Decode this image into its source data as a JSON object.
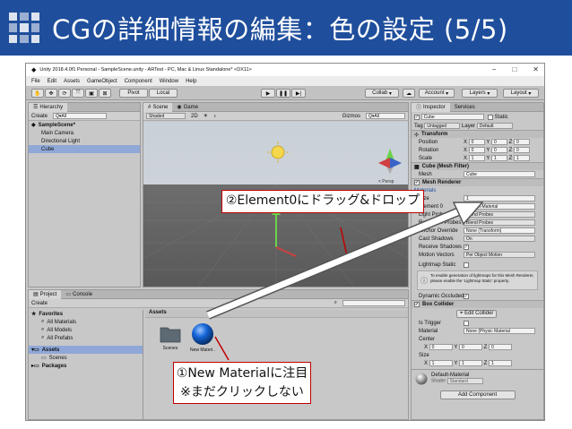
{
  "slide": {
    "title": "CGの詳細情報の編集：色の設定 (5/5)"
  },
  "window": {
    "title": "Unity 2018.4.0f1 Personal - SampleScene.unity - ARTest - PC, Mac & Linux Standalone* <DX11>",
    "controls": [
      "−",
      "□",
      "✕"
    ]
  },
  "menu": [
    "File",
    "Edit",
    "Assets",
    "GameObject",
    "Component",
    "Window",
    "Help"
  ],
  "toolbar": {
    "pivot": "Pivot",
    "local": "Local",
    "collab": "Collab",
    "account": "Account",
    "layers": "Layers",
    "layout": "Layout"
  },
  "hierarchy": {
    "tab": "Hierarchy",
    "create": "Create",
    "search_placeholder": "Q▾All",
    "items": [
      "SampleScene*",
      "Main Camera",
      "Directional Light",
      "Cube"
    ]
  },
  "scene": {
    "tab_scene": "Scene",
    "tab_game": "Game",
    "shaded": "Shaded",
    "mode_2d": "2D",
    "gizmos": "Gizmos",
    "search": "Q▾All",
    "persp": "< Persp"
  },
  "project": {
    "tab_project": "Project",
    "tab_console": "Console",
    "create": "Create",
    "favorites": "Favorites",
    "fav_items": [
      "All Materials",
      "All Models",
      "All Prefabs"
    ],
    "assets": "Assets",
    "asset_items": [
      "Scenes"
    ],
    "packages": "Packages",
    "breadcrumb": "Assets",
    "grid": [
      {
        "name": "Scenes",
        "kind": "folder"
      },
      {
        "name": "New Materi..",
        "kind": "material"
      }
    ]
  },
  "inspector": {
    "tab_inspector": "Inspector",
    "tab_services": "Services",
    "object_name": "Cube",
    "static_label": "Static",
    "tag_label": "Tag",
    "tag_value": "Untagged",
    "layer_label": "Layer",
    "layer_value": "Default",
    "transform": {
      "header": "Transform",
      "rows": [
        {
          "label": "Position",
          "x": "0",
          "y": "0",
          "z": "0"
        },
        {
          "label": "Rotation",
          "x": "0",
          "y": "0",
          "z": "0"
        },
        {
          "label": "Scale",
          "x": "1",
          "y": "1",
          "z": "1"
        }
      ]
    },
    "mesh_filter": {
      "header": "Cube (Mesh Filter)",
      "mesh_label": "Mesh",
      "mesh_value": "Cube"
    },
    "mesh_renderer": {
      "header": "Mesh Renderer",
      "materials": "Materials",
      "size_label": "Size",
      "size_value": "1",
      "element0_label": "Element 0",
      "element0_value": "Default-Material",
      "light_probes_label": "Light Probes",
      "light_probes_value": "Blend Probes",
      "reflection_label": "Reflection Probes",
      "reflection_value": "Blend Probes",
      "anchor_label": "Anchor Override",
      "anchor_value": "None (Transform)",
      "cast_label": "Cast Shadows",
      "cast_value": "On",
      "receive_label": "Receive Shadows",
      "motion_label": "Motion Vectors",
      "motion_value": "Per Object Motion",
      "lightmap_label": "Lightmap Static",
      "lightmap_note": "To enable generation of lightmaps for this Mesh Renderer, please enable the 'Lightmap Static' property.",
      "dynamic_label": "Dynamic Occluded"
    },
    "box_collider": {
      "header": "Box Collider",
      "edit_label": "Edit Collider",
      "trigger_label": "Is Trigger",
      "material_label": "Material",
      "material_value": "None (Physic Material",
      "center_label": "Center",
      "center": {
        "x": "0",
        "y": "0",
        "z": "0"
      },
      "size_label": "Size",
      "size": {
        "x": "1",
        "y": "1",
        "z": "1"
      }
    },
    "default_material": {
      "name": "Default-Material",
      "shader_label": "Shader",
      "shader_value": "Standard"
    },
    "add_component": "Add Component"
  },
  "callouts": {
    "drag": "②Element0にドラッグ&ドロップ",
    "focus_line1": "①New Materialに注目",
    "focus_line2": "※まだクリックしない"
  },
  "colors": {
    "header_bg": "#1f4e9c",
    "callout_border": "#c00000",
    "material_sphere": "#1565d8"
  }
}
